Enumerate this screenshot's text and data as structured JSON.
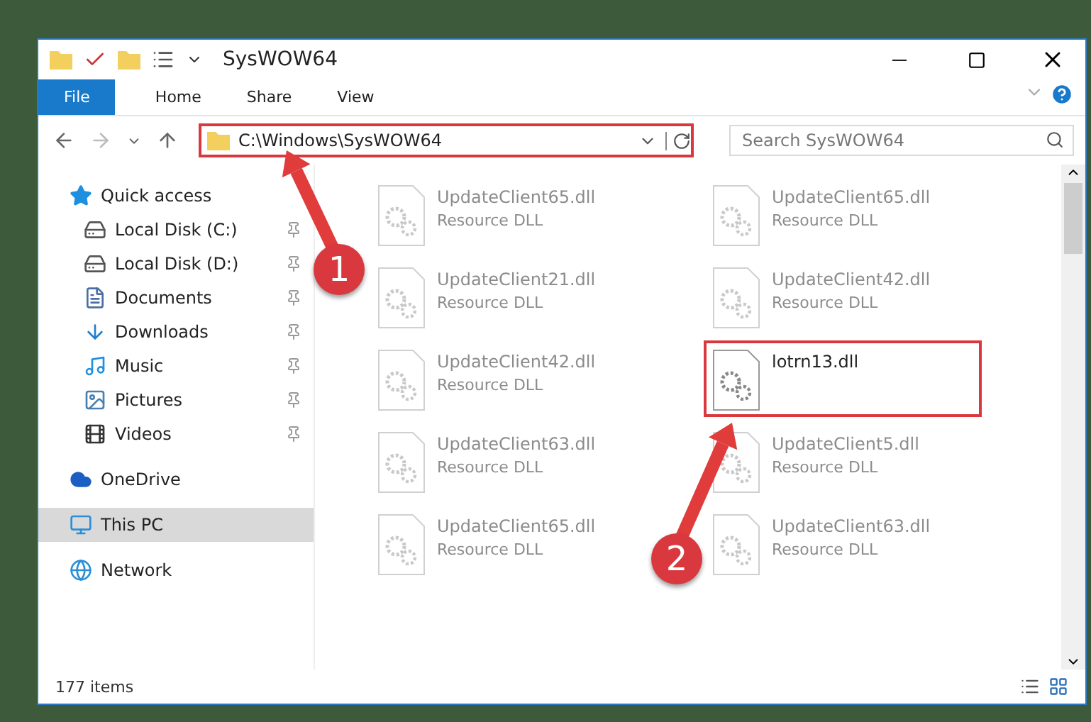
{
  "window": {
    "title": "SysWOW64"
  },
  "ribbon_tabs": [
    {
      "label": "File",
      "selected": true
    },
    {
      "label": "Home",
      "selected": false
    },
    {
      "label": "Share",
      "selected": false
    },
    {
      "label": "View",
      "selected": false
    }
  ],
  "address": {
    "value": "C:\\Windows\\SysWOW64",
    "highlighted": true
  },
  "search": {
    "placeholder": "Search SysWOW64"
  },
  "nav": [
    {
      "label": "Quick access",
      "kind": "star",
      "selected": false,
      "children": [
        {
          "label": "Local Disk (C:)",
          "kind": "system-drive",
          "selected": false,
          "pinned": true
        },
        {
          "label": "Local Disk (D:)",
          "kind": "drive",
          "selected": false,
          "pinned": true
        },
        {
          "label": "Documents",
          "kind": "documents",
          "selected": false,
          "pinned": true
        },
        {
          "label": "Downloads",
          "kind": "downloads",
          "selected": false,
          "pinned": true
        },
        {
          "label": "Music",
          "kind": "music",
          "selected": false,
          "pinned": true
        },
        {
          "label": "Pictures",
          "kind": "pictures",
          "selected": false,
          "pinned": true
        },
        {
          "label": "Videos",
          "kind": "videos",
          "selected": false,
          "pinned": true
        }
      ]
    },
    {
      "label": "OneDrive",
      "kind": "cloud",
      "selected": false
    },
    {
      "label": "This PC",
      "kind": "pc",
      "selected": true
    },
    {
      "label": "Network",
      "kind": "network",
      "selected": false
    }
  ],
  "files": [
    {
      "name": "UpdateClient65.dll",
      "type": "Resource DLL",
      "faded": true,
      "highlighted": false
    },
    {
      "name": "UpdateClient65.dll",
      "type": "Resource DLL",
      "faded": true,
      "highlighted": false
    },
    {
      "name": "UpdateClient21.dll",
      "type": "Resource DLL",
      "faded": true,
      "highlighted": false
    },
    {
      "name": "UpdateClient42.dll",
      "type": "Resource DLL",
      "faded": true,
      "highlighted": false
    },
    {
      "name": "UpdateClient42.dll",
      "type": "Resource DLL",
      "faded": true,
      "highlighted": false
    },
    {
      "name": "lotrn13.dll",
      "faded": false,
      "highlighted": true
    },
    {
      "name": "UpdateClient63.dll",
      "type": "Resource DLL",
      "faded": true,
      "highlighted": false
    },
    {
      "name": "UpdateClient5.dll",
      "type": "Resource DLL",
      "faded": true,
      "highlighted": false
    },
    {
      "name": "UpdateClient65.dll",
      "type": "Resource DLL",
      "faded": true,
      "highlighted": false
    },
    {
      "name": "UpdateClient63.dll",
      "type": "Resource DLL",
      "faded": true,
      "highlighted": false
    }
  ],
  "status_bar": {
    "count": "177 items"
  },
  "callouts": [
    {
      "number": "1"
    },
    {
      "number": "2"
    }
  ]
}
